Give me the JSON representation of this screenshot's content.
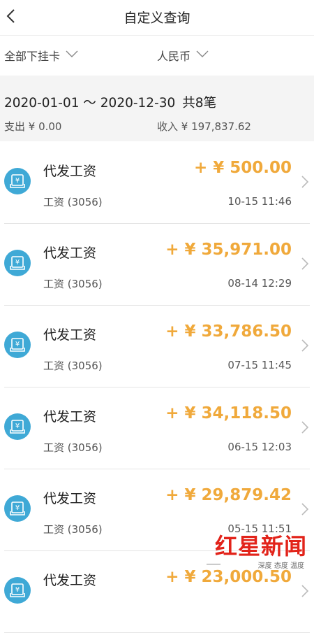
{
  "nav": {
    "title": "自定义查询",
    "back_icon": "chevron-left-icon"
  },
  "filters": {
    "card": "全部下挂卡",
    "currency": "人民币"
  },
  "summary": {
    "date_range": "2020-01-01 ～ 2020-12-30",
    "count": "共8笔",
    "expense": "支出 ¥ 0.00",
    "income": "收入 ¥ 197,837.62"
  },
  "transactions": [
    {
      "name": "代发工资",
      "account": "工资 (3056)",
      "amount": "+ ¥ 500.00",
      "time": "10-15 11:46"
    },
    {
      "name": "代发工资",
      "account": "工资 (3056)",
      "amount": "+ ¥ 35,971.00",
      "time": "08-14 12:29"
    },
    {
      "name": "代发工资",
      "account": "工资 (3056)",
      "amount": "+ ¥ 33,786.50",
      "time": "07-15 11:45"
    },
    {
      "name": "代发工资",
      "account": "工资 (3056)",
      "amount": "+ ¥ 34,118.50",
      "time": "06-15 12:03"
    },
    {
      "name": "代发工资",
      "account": "工资 (3056)",
      "amount": "+ ¥ 29,879.42",
      "time": "05-15 11:51"
    },
    {
      "name": "代发工资",
      "account": "",
      "amount": "+ ¥ 23,000.50",
      "time": ""
    }
  ],
  "colors": {
    "amount": "#f0a93b",
    "icon_bg": "#3fa9d6",
    "watermark": "#e2231a"
  },
  "watermark": {
    "logo": "红星新闻",
    "tagline": "深度 态度 温度"
  }
}
